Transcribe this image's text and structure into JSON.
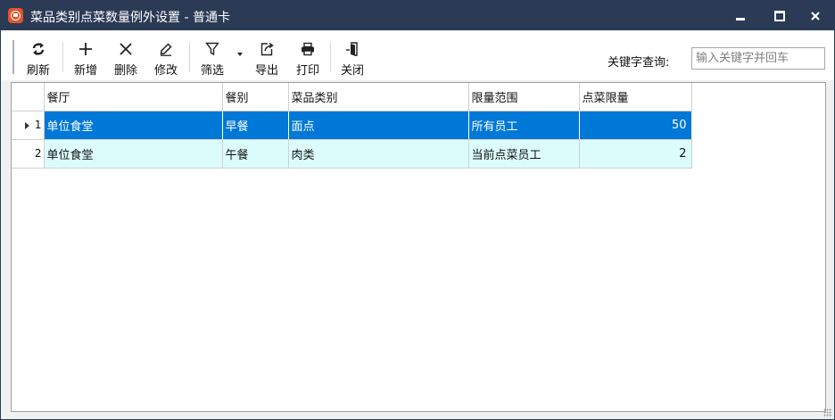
{
  "window": {
    "title": "菜品类别点菜数量例外设置 - 普通卡",
    "icon": "app-logo-icon",
    "title_bar_color": "#2b3a55"
  },
  "toolbar": {
    "buttons": [
      {
        "label": "刷新",
        "icon": "refresh-icon"
      },
      {
        "label": "新增",
        "icon": "plus-icon"
      },
      {
        "label": "删除",
        "icon": "x-icon"
      },
      {
        "label": "修改",
        "icon": "pencil-icon"
      },
      {
        "label": "筛选",
        "icon": "filter-icon"
      },
      {
        "label": "导出",
        "icon": "export-icon"
      },
      {
        "label": "打印",
        "icon": "printer-icon"
      },
      {
        "label": "关闭",
        "icon": "exit-door-icon"
      }
    ]
  },
  "search": {
    "label": "关键字查询:",
    "placeholder": "输入关键字并回车",
    "value": ""
  },
  "grid": {
    "columns": [
      "餐厅",
      "餐别",
      "菜品类别",
      "限量范围",
      "点菜限量"
    ],
    "rows": [
      {
        "index": "1",
        "cells": [
          "单位食堂",
          "早餐",
          "面点",
          "所有员工",
          "50"
        ],
        "current": true
      },
      {
        "index": "2",
        "cells": [
          "单位食堂",
          "午餐",
          "肉类",
          "当前点菜员工",
          "2"
        ],
        "current": false
      }
    ],
    "selection_color": "#0078d7",
    "alt_row_color": "#dcfcfc"
  }
}
